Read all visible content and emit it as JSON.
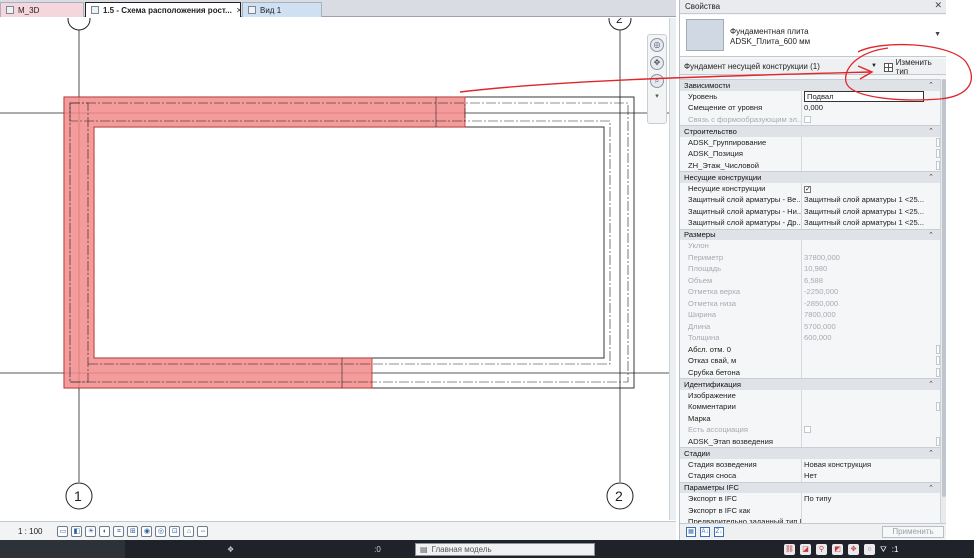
{
  "tabs": [
    {
      "label": "M_3D"
    },
    {
      "label": "1.5 - Схема расположения рост..."
    },
    {
      "label": "Вид 1"
    }
  ],
  "grid": {
    "bubble_left": "1",
    "bubble_right": "2"
  },
  "view_bar": {
    "scale": "1 : 100"
  },
  "status_bar": {
    "coord": ":0",
    "model": "Главная модель",
    "filter": ":1"
  },
  "properties": {
    "title": "Свойства",
    "type_family": "Фундаментная плита",
    "type_name": "ADSK_Плита_600 мм",
    "selection_filter": "Фундамент несущей конструкции (1)",
    "edit_type": "Изменить тип",
    "apply": "Применить",
    "groups": [
      {
        "name": "Зависимости",
        "rows": [
          {
            "name": "Уровень",
            "value": "Подвал",
            "kind": "input"
          },
          {
            "name": "Смещение от уровня",
            "value": "0,000"
          },
          {
            "name": "Связь с формообразующим эл...",
            "value": "",
            "kind": "check-dim",
            "dim": true
          }
        ]
      },
      {
        "name": "Строительство",
        "rows": [
          {
            "name": "ADSK_Группирование",
            "value": "",
            "kind": "box"
          },
          {
            "name": "ADSK_Позиция",
            "value": "",
            "kind": "box"
          },
          {
            "name": "ZH_Этаж_Числовой",
            "value": "",
            "kind": "box"
          }
        ]
      },
      {
        "name": "Несущие конструкции",
        "rows": [
          {
            "name": "Несущие конструкции",
            "value": "✓",
            "kind": "check"
          },
          {
            "name": "Защитный слой арматуры - Ве...",
            "value": "Защитный слой арматуры 1 <25..."
          },
          {
            "name": "Защитный слой арматуры - Ни...",
            "value": "Защитный слой арматуры 1 <25..."
          },
          {
            "name": "Защитный слой арматуры - Др...",
            "value": "Защитный слой арматуры 1 <25..."
          }
        ]
      },
      {
        "name": "Размеры",
        "rows": [
          {
            "name": "Уклон",
            "value": "",
            "dim": true
          },
          {
            "name": "Периметр",
            "value": "37800,000",
            "dim": true
          },
          {
            "name": "Площадь",
            "value": "10,980",
            "dim": true
          },
          {
            "name": "Объем",
            "value": "6,588",
            "dim": true
          },
          {
            "name": "Отметка верха",
            "value": "-2250,000",
            "dim": true
          },
          {
            "name": "Отметка низа",
            "value": "-2850,000",
            "dim": true
          },
          {
            "name": "Ширина",
            "value": "7800,000",
            "dim": true
          },
          {
            "name": "Длина",
            "value": "5700,000",
            "dim": true
          },
          {
            "name": "Толщина",
            "value": "600,000",
            "dim": true
          },
          {
            "name": "Абсл. отм. 0",
            "value": "",
            "kind": "box"
          },
          {
            "name": "Отказ свай, м",
            "value": "",
            "kind": "box"
          },
          {
            "name": "Срубка бетона",
            "value": "",
            "kind": "box"
          }
        ]
      },
      {
        "name": "Идентификация",
        "rows": [
          {
            "name": "Изображение",
            "value": ""
          },
          {
            "name": "Комментарии",
            "value": "",
            "kind": "box"
          },
          {
            "name": "Марка",
            "value": ""
          },
          {
            "name": "Есть ассоциация",
            "value": "",
            "kind": "check-dim",
            "dim": true
          },
          {
            "name": "ADSK_Этап возведения",
            "value": "",
            "kind": "box"
          }
        ]
      },
      {
        "name": "Стадии",
        "rows": [
          {
            "name": "Стадия возведения",
            "value": "Новая конструкция"
          },
          {
            "name": "Стадия сноса",
            "value": "Нет"
          }
        ]
      },
      {
        "name": "Параметры IFC",
        "rows": [
          {
            "name": "Экспорт в IFC",
            "value": "По типу"
          },
          {
            "name": "Экспорт в IFC как",
            "value": ""
          },
          {
            "name": "Предварительно заданный тип I...",
            "value": ""
          }
        ]
      }
    ]
  },
  "colors": {
    "highlight": "#f28b8b",
    "annotation": "#e0262b",
    "group_bg": "#dfe3e8"
  }
}
